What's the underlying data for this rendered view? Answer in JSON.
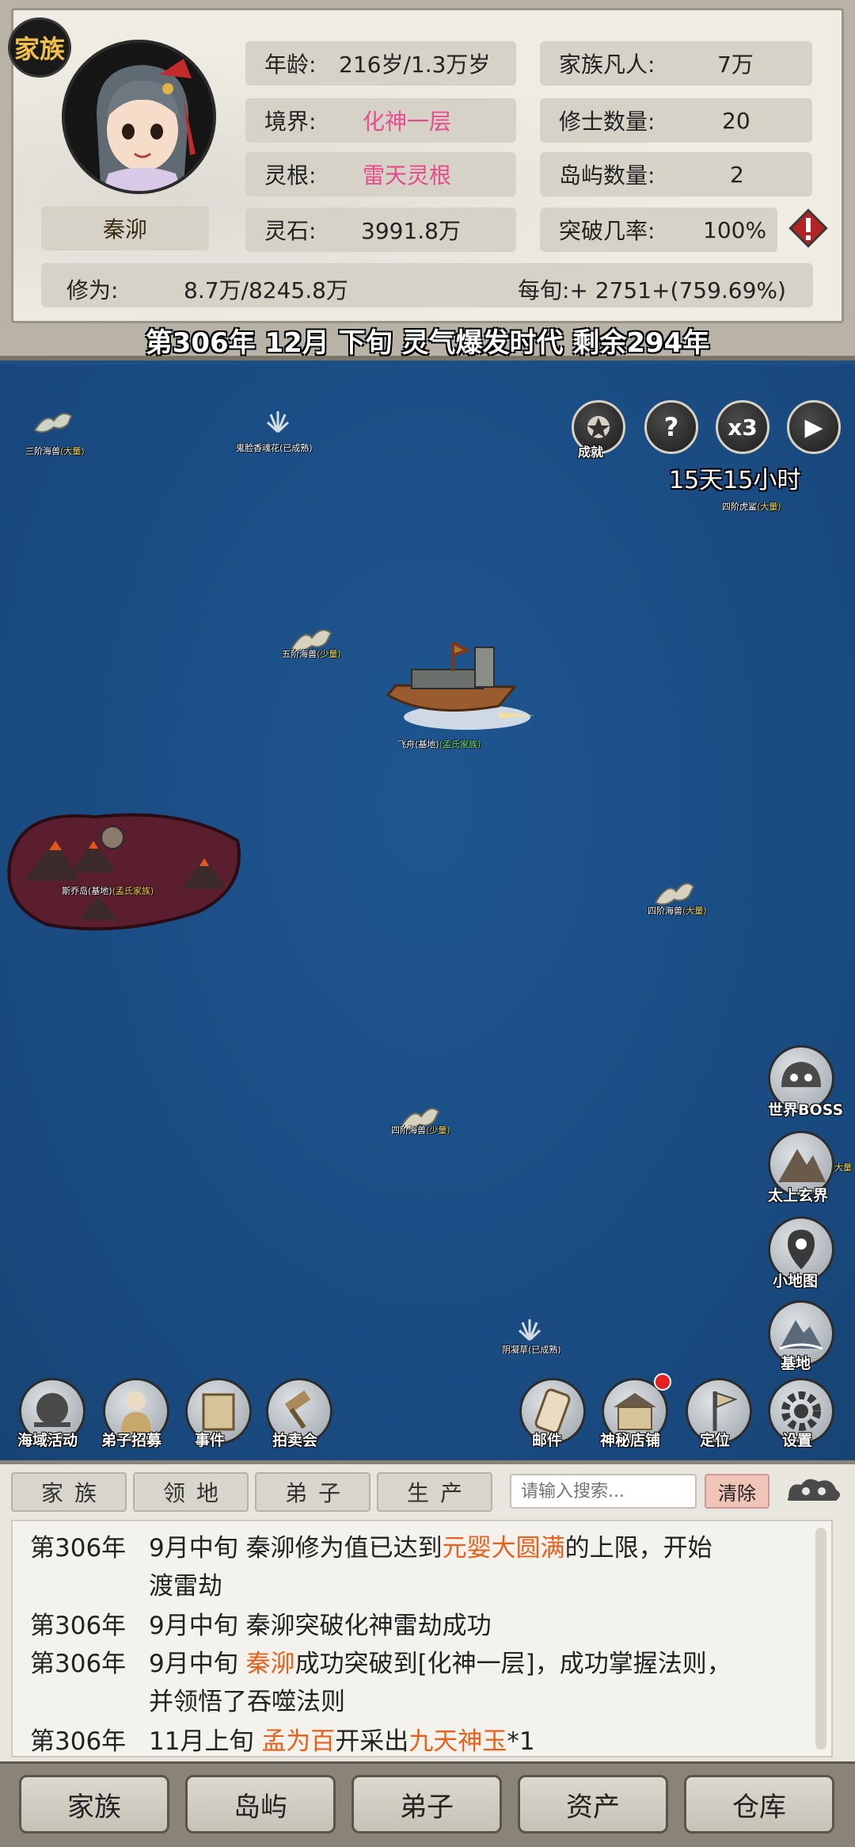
{
  "header": {
    "clan_badge": "家族",
    "character_name": "秦泖",
    "stats": {
      "age_label": "年龄:",
      "age_value": "216岁/1.3万岁",
      "realm_label": "境界:",
      "realm_value": "化神一层",
      "root_label": "灵根:",
      "root_value": "雷天灵根",
      "stone_label": "灵石:",
      "stone_value": "3991.8万",
      "mortals_label": "家族凡人:",
      "mortals_value": "7万",
      "cultivators_label": "修士数量:",
      "cultivators_value": "20",
      "islands_label": "岛屿数量:",
      "islands_value": "2",
      "breakthrough_label": "突破几率:",
      "breakthrough_value": "100%"
    },
    "cultivation_label": "修为:",
    "cultivation_value": "8.7万/8245.8万",
    "per_period": "每旬:+ 2751+(759.69%)",
    "era_text": "第306年 12月 下旬  灵气爆发时代 剩余294年"
  },
  "map": {
    "timer": "15天15小时",
    "controls": {
      "achievement": "成就",
      "help": "?",
      "speed": "x3",
      "play": "▶"
    },
    "labels": {
      "beast1_name": "三阶海兽",
      "beast1_tag": "(大量)",
      "herb1": "鬼脸香魂花(已成熟)",
      "beast2_name": "四阶虎鲨",
      "beast2_tag": "(大量)",
      "beast3_name": "五阶海兽",
      "beast3_tag": "(少量)",
      "ship_name": "飞舟(基地)",
      "ship_tag": "(孟氏家族)",
      "island_name": "斯乔岛(基地)",
      "island_tag": "(孟氏家族)",
      "beast4_name": "四阶海兽",
      "beast4_tag": "(大量)",
      "beast5_name": "四阶海兽",
      "beast5_tag": "(少量)",
      "herb2": "阴凝草(已成熟)",
      "side_tag": "大量"
    },
    "side_buttons": [
      "世界BOSS",
      "太上玄界",
      "小地图",
      "基地"
    ],
    "bottom_left_buttons": [
      "海域活动",
      "弟子招募",
      "事件",
      "拍卖会"
    ],
    "bottom_right_buttons": [
      "邮件",
      "神秘店铺",
      "定位",
      "设置"
    ]
  },
  "log": {
    "tabs": [
      "家族",
      "领地",
      "弟子",
      "生产"
    ],
    "search_placeholder": "请输入搜索...",
    "clear_label": "清除",
    "entries": {
      "e1_year": "第306年",
      "e1_a": "9月中旬 秦泖修为值已达到",
      "e1_hl": "元婴大圆满",
      "e1_b": "的上限，开始",
      "e1_cont": "渡雷劫",
      "e2_year": "第306年",
      "e2_a": "9月中旬 秦泖突破化神雷劫成功",
      "e3_year": "第306年",
      "e3_a": "9月中旬 ",
      "e3_hl": "秦泖",
      "e3_b": "成功突破到[化神一层]，成功掌握法则，",
      "e3_cont": "并领悟了吞噬法则",
      "e4_year": "第306年",
      "e4_a": "11月上旬 ",
      "e4_hl": "孟为百",
      "e4_b": "开采出",
      "e4_hl2": "九天神玉",
      "e4_c": "*1"
    }
  },
  "nav": [
    "家族",
    "岛屿",
    "弟子",
    "资产",
    "仓库"
  ],
  "colors": {
    "sea": "#1b4f86",
    "highlight_pink": "#e64c8e",
    "highlight_orange": "#e8601c"
  }
}
